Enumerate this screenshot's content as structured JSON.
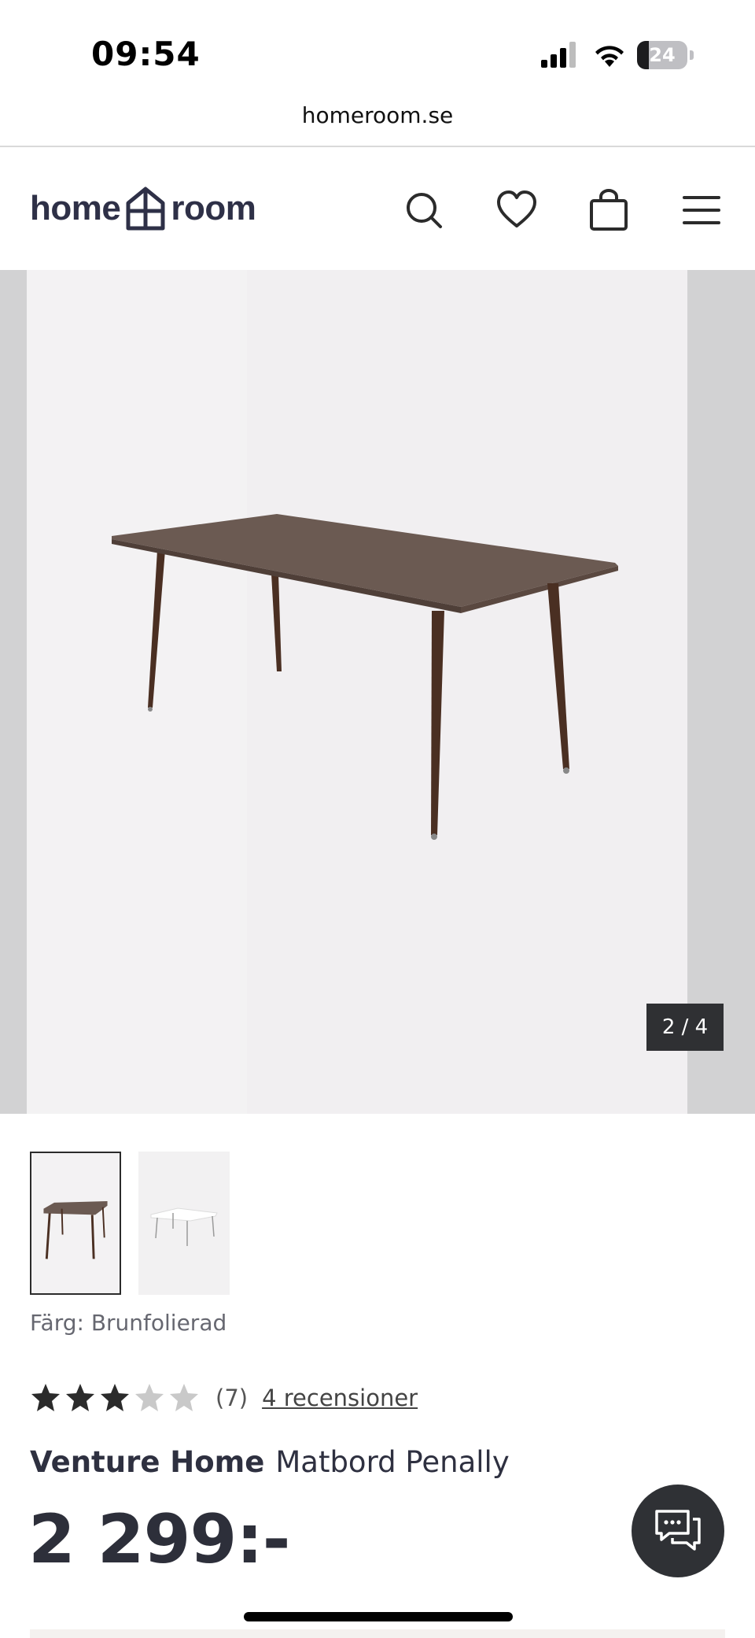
{
  "status_bar": {
    "time": "09:54",
    "battery_level": "24",
    "battery_fraction": 0.24
  },
  "browser": {
    "url": "homeroom.se"
  },
  "header": {
    "logo_left": "home",
    "logo_right": "room",
    "brand_color": "#2e3047",
    "icons": [
      "search-icon",
      "heart-icon",
      "shopping-bag-icon",
      "menu-icon"
    ]
  },
  "gallery": {
    "counter": "2 / 4",
    "current": 2,
    "total": 4
  },
  "product": {
    "color_label": "Färg: Brunfolierad",
    "rating": 3,
    "rating_max": 5,
    "rating_count": "(7)",
    "reviews_link": "4 recensioner",
    "brand": "Venture Home",
    "name": "Matbord Penally",
    "price": "2 299:-"
  },
  "colors": {
    "table_top": "#6b5a52",
    "table_legs": "#4a2f22",
    "star_filled": "#2b2b2b",
    "star_empty": "#c9c9c9"
  }
}
